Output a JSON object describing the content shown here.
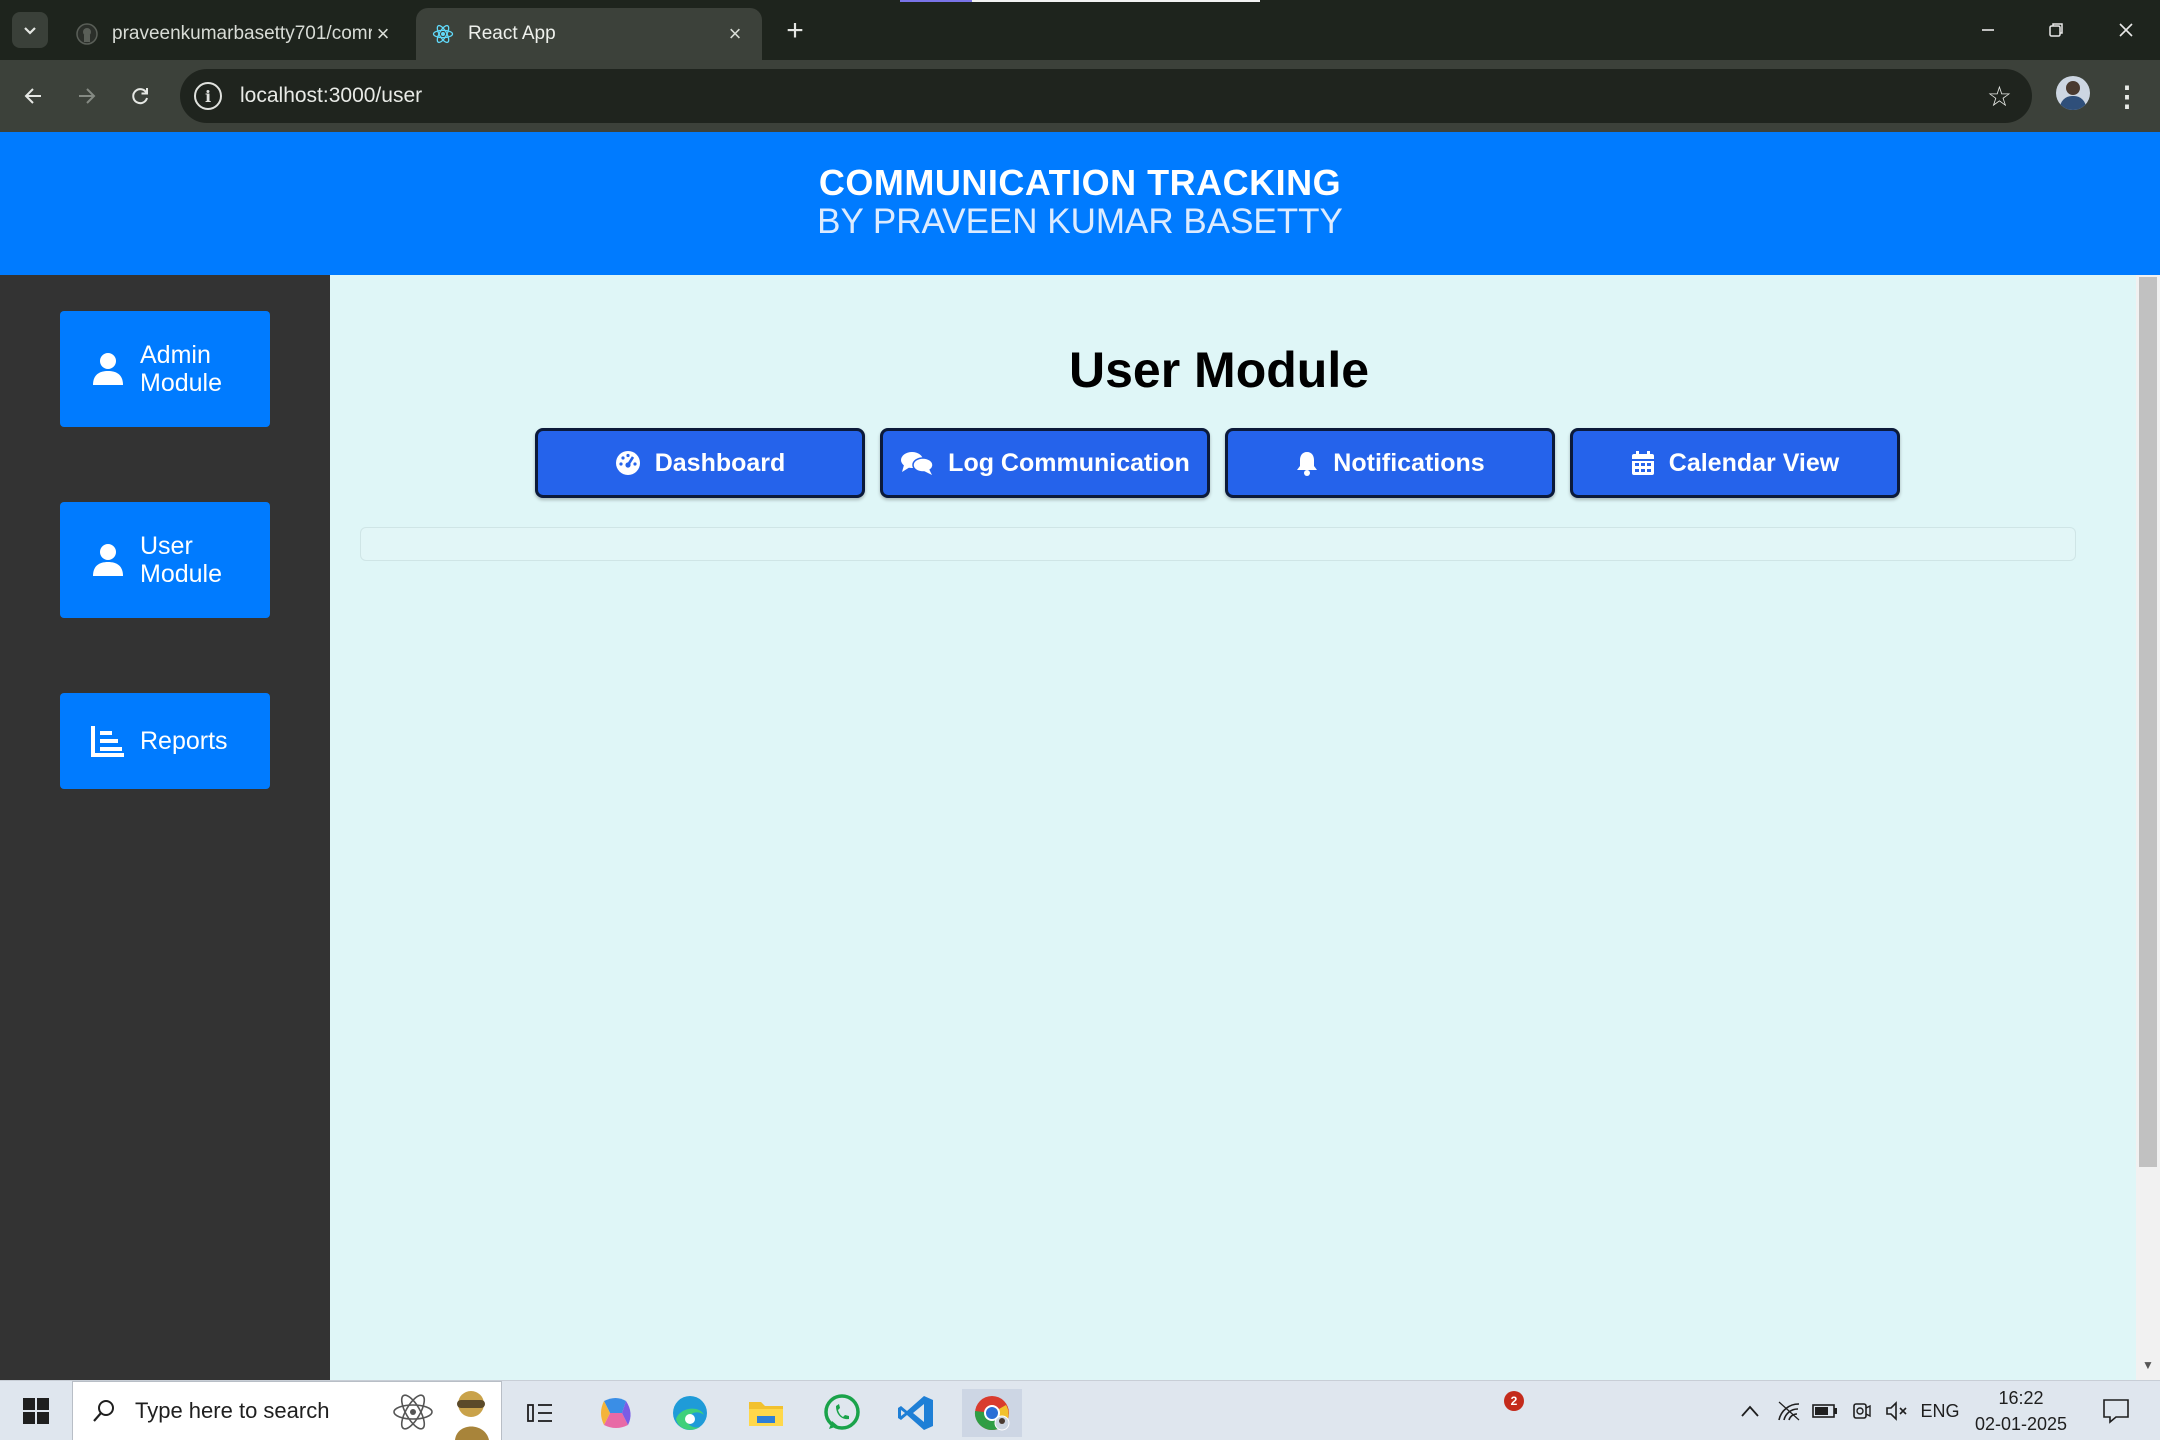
{
  "browser": {
    "tabs": [
      {
        "title": "praveenkumarbasetty701/comr",
        "active": false,
        "icon": "github-icon"
      },
      {
        "title": "React App",
        "active": true,
        "icon": "react-icon"
      }
    ],
    "url": "localhost:3000/user"
  },
  "header": {
    "title": "COMMUNICATION TRACKING",
    "subtitle": "BY PRAVEEN KUMAR BASETTY"
  },
  "sidebar": {
    "items": [
      {
        "label_line1": "Admin",
        "label_line2": "Module",
        "icon": "user-icon"
      },
      {
        "label_line1": "User",
        "label_line2": "Module",
        "icon": "user-icon"
      },
      {
        "label": "Reports",
        "icon": "bar-chart-icon"
      }
    ]
  },
  "main": {
    "title": "User Module",
    "tabs": [
      {
        "label": "Dashboard",
        "icon": "gauge-icon"
      },
      {
        "label": "Log Communication",
        "icon": "comments-icon"
      },
      {
        "label": "Notifications",
        "icon": "bell-icon"
      },
      {
        "label": "Calendar View",
        "icon": "calendar-icon"
      }
    ]
  },
  "taskbar": {
    "search_placeholder": "Type here to search",
    "notification_count": "2",
    "language": "ENG",
    "time": "16:22",
    "date": "02-01-2025"
  },
  "colors": {
    "header_bg": "#007bff",
    "sidebar_bg": "#333333",
    "content_bg": "#dff6f7",
    "tab_button_bg": "#2563eb"
  }
}
